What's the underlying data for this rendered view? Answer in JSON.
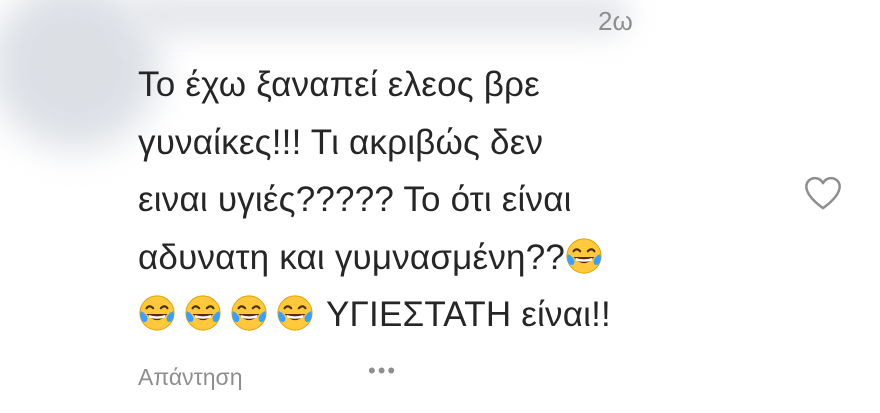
{
  "comment": {
    "timestamp": "2ω",
    "lines": [
      "Το έχω ξαναπεί ελεος βρε",
      "γυναίκες!!! Τι ακριβώς δεν",
      "ειναι υγιές????? Το ότι είναι",
      "αδυνατη και γυμνασμένη??",
      "ΥΓΙΕΣΤΑΤΗ είναι!!"
    ],
    "emoji_name": "face-with-tears-of-joy",
    "reply_label": "Απάντηση",
    "more_label": "•••",
    "like_icon": "heart-icon"
  }
}
